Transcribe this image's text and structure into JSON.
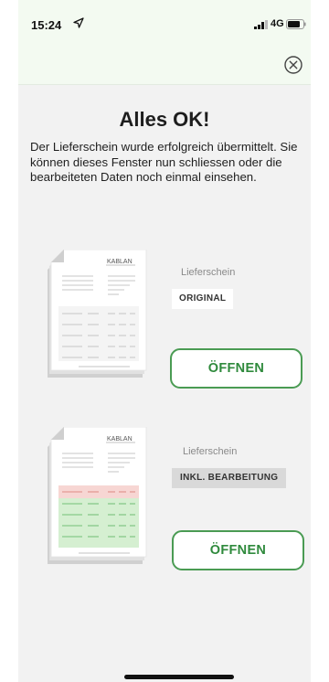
{
  "status_bar": {
    "time": "15:24",
    "network": "4G",
    "icons": [
      "location-arrow-icon",
      "signal-bars-icon",
      "battery-icon"
    ]
  },
  "header": {
    "close_icon": "close-circle-icon"
  },
  "main": {
    "title": "Alles OK!",
    "description": "Der Lieferschein wurde erfolgreich übermittelt. Sie können dieses Fenster nun schliessen oder die bearbeiteten Daten noch einmal einsehen."
  },
  "documents": [
    {
      "logo": "KABLAN",
      "label": "Lieferschein",
      "badge": "ORIGINAL",
      "button": "ÖFFNEN"
    },
    {
      "logo": "KABLAN",
      "label": "Lieferschein",
      "badge": "INKL. BEARBEITUNG",
      "button": "ÖFFNEN"
    }
  ],
  "colors": {
    "accent_green": "#2f8a3c",
    "button_border": "#4a9b53",
    "header_bg": "#f3faf1",
    "highlight_red": "#f7d6d3",
    "highlight_green": "#d5efd1"
  }
}
